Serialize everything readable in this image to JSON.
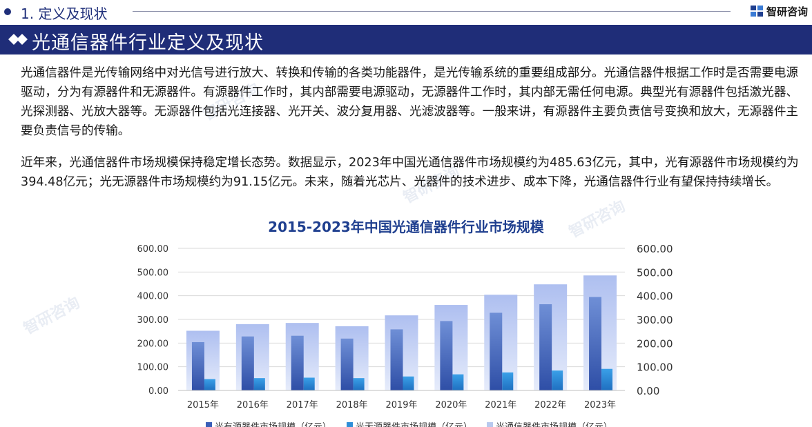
{
  "header": {
    "section_label": "1. 定义及现状",
    "logo_text": "智研咨询"
  },
  "title_bar": {
    "title": "光通信器件行业定义及现状"
  },
  "paragraphs": [
    "光通信器件是光传输网络中对光信号进行放大、转换和传输的各类功能器件，是光传输系统的重要组成部分。光通信器件根据工作时是否需要电源驱动，分为有源器件和无源器件。有源器件工作时，其内部需要电源驱动，无源器件工作时，其内部无需任何电源。典型光有源器件包括激光器、光探测器、光放大器等。无源器件包括光连接器、光开关、波分复用器、光滤波器等。一般来讲，有源器件主要负责信号变换和放大，无源器件主要负责信号的传输。",
    "近年来，光通信器件市场规模保持稳定增长态势。数据显示，2023年中国光通信器件市场规模约为485.63亿元，其中，光有源器件市场规模约为394.48亿元；光无源器件市场规模约为91.15亿元。未来，随着光芯片、光器件的技术进步、成本下降，光通信器件行业有望保持持续增长。"
  ],
  "chart_data": {
    "type": "bar",
    "title": "2015-2023年中国光通信器件行业市场规模",
    "categories": [
      "2015年",
      "2016年",
      "2017年",
      "2018年",
      "2019年",
      "2020年",
      "2021年",
      "2022年",
      "2023年"
    ],
    "series": [
      {
        "name": "光有源器件市场规模（亿元）",
        "values": [
          204,
          228,
          231,
          219,
          258,
          293,
          328,
          364,
          394.48
        ],
        "color": "#3a5fb8"
      },
      {
        "name": "光无源器件市场规模（亿元）",
        "values": [
          48,
          52,
          54,
          52,
          59,
          68,
          76,
          84,
          91.15
        ],
        "color": "#2f8fd8"
      },
      {
        "name": "光通信器件市场规模（亿元）",
        "values": [
          252,
          280,
          285,
          271,
          317,
          361,
          404,
          448,
          485.63
        ],
        "color": "#b8c9ee"
      }
    ],
    "y_ticks": [
      "0.00",
      "100.00",
      "200.00",
      "300.00",
      "400.00",
      "500.00",
      "600.00"
    ],
    "ylim": [
      0,
      600
    ],
    "legend_position": "bottom",
    "grid": true
  }
}
